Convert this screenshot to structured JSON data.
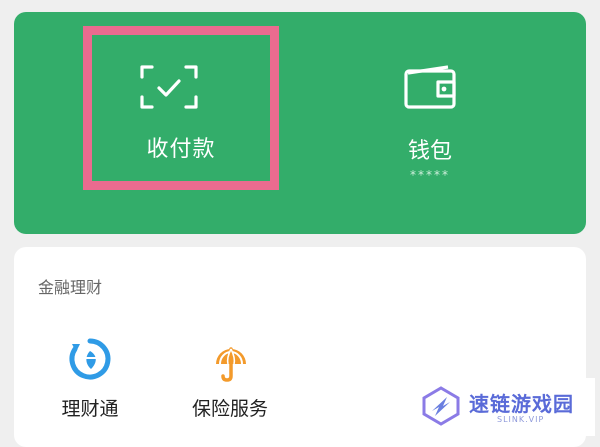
{
  "top_panel": {
    "pay_label": "收付款",
    "wallet_label": "钱包",
    "wallet_balance": "*****",
    "pay_icon": "scan-icon",
    "wallet_icon": "wallet-icon"
  },
  "finance": {
    "title": "金融理财",
    "items": [
      {
        "label": "理财通",
        "icon": "licaitong-icon"
      },
      {
        "label": "保险服务",
        "icon": "umbrella-icon"
      }
    ]
  },
  "watermark": {
    "text": "速链游戏园",
    "sub": "SLINK.VIP"
  },
  "colors": {
    "green": "#33ad6a",
    "highlight": "#ea6b8f",
    "blue": "#2f9be6",
    "orange": "#f39a2b"
  }
}
